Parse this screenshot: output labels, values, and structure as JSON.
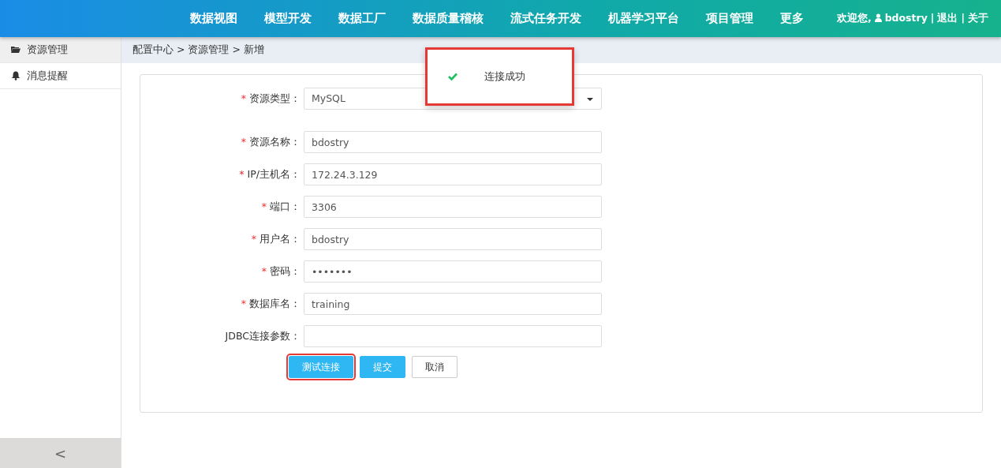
{
  "nav": {
    "items": [
      {
        "label": "数据视图"
      },
      {
        "label": "模型开发"
      },
      {
        "label": "数据工厂"
      },
      {
        "label": "数据质量稽核"
      },
      {
        "label": "流式任务开发"
      },
      {
        "label": "机器学习平台"
      },
      {
        "label": "项目管理"
      },
      {
        "label": "更多"
      }
    ],
    "user": {
      "greeting": "欢迎您,",
      "name": "bdostry",
      "links": [
        {
          "separator": "|",
          "label": "退出"
        },
        {
          "separator": "|",
          "label": "关于"
        }
      ]
    }
  },
  "sidebar": {
    "items": [
      {
        "label": "资源管理",
        "kind": "folder",
        "selected": true
      },
      {
        "label": "消息提醒",
        "kind": "bell",
        "selected": false
      }
    ],
    "collapse": "<"
  },
  "breadcrumb": [
    {
      "label": "配置中心"
    },
    {
      "separator": ">",
      "label": "资源管理"
    },
    {
      "separator": ">",
      "label": "新增"
    }
  ],
  "form": {
    "fields": [
      {
        "kind": "select",
        "required_mark": "*",
        "label": "资源类型：",
        "value": "MySQL"
      },
      {
        "kind": "text",
        "required_mark": "*",
        "label": "资源名称：",
        "value": "bdostry"
      },
      {
        "kind": "text",
        "required_mark": "*",
        "label": "IP/主机名：",
        "value": "172.24.3.129"
      },
      {
        "kind": "text",
        "required_mark": "*",
        "label": "端口：",
        "value": "3306"
      },
      {
        "kind": "text",
        "required_mark": "*",
        "label": "用户名：",
        "value": "bdostry"
      },
      {
        "kind": "password",
        "required_mark": "*",
        "label": "密码：",
        "value": "•••••••"
      },
      {
        "kind": "text",
        "required_mark": "*",
        "label": "数据库名：",
        "value": "training"
      },
      {
        "kind": "text",
        "label": "JDBC连接参数："
      }
    ],
    "buttons": [
      {
        "label": "测试连接",
        "kind": "primary",
        "highlighted": true
      },
      {
        "label": "提交",
        "kind": "primary",
        "highlighted": false
      },
      {
        "label": "取消",
        "kind": "default",
        "highlighted": false
      }
    ]
  },
  "toast": {
    "text": "连接成功",
    "highlighted": true
  }
}
